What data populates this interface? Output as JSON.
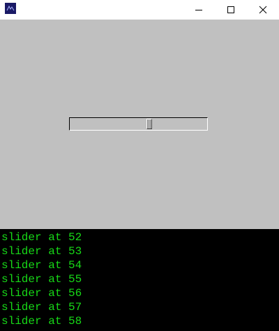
{
  "window": {
    "icon": "app-icon",
    "controls": [
      "minimize-icon",
      "maximize-icon",
      "close-icon"
    ]
  },
  "slider": {
    "min": 0,
    "max": 100,
    "value": 58
  },
  "colors": {
    "client_background": "#c0c0c0",
    "console_background": "#000000",
    "console_text": "#17d917"
  },
  "console": {
    "lines": [
      "slider at 52",
      "slider at 53",
      "slider at 54",
      "slider at 55",
      "slider at 56",
      "slider at 57",
      "slider at 58"
    ]
  }
}
